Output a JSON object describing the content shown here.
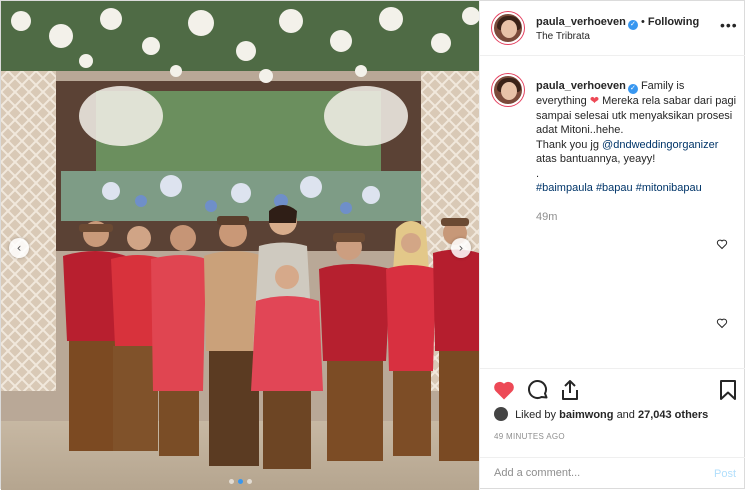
{
  "header": {
    "username": "paula_verhoeven",
    "separator": "•",
    "follow_status": "Following",
    "location": "The Tribrata",
    "more_icon": "more-horizontal-icon"
  },
  "caption": {
    "username": "paula_verhoeven",
    "text_1": "Family is everything",
    "text_2": "Mereka rela sabar dari pagi sampai selesai utk menyaksikan prosesi adat Mitoni..hehe.",
    "text_3": "Thank you jg",
    "mention": "@dndweddingorganizer",
    "text_4": "atas bantuannya, yeayy!",
    "dot_line": ".",
    "hashtags": [
      "#baimpaula",
      "#bapau",
      "#mitonibapau"
    ],
    "time": "49m"
  },
  "actions": {
    "like_icon": "heart-filled-icon",
    "comment_icon": "comment-icon",
    "share_icon": "share-icon",
    "save_icon": "bookmark-icon",
    "liked": true
  },
  "likes": {
    "prefix": "Liked by",
    "liker": "baimwong",
    "connector": "and",
    "others": "27,043 others"
  },
  "post_age": "49 MINUTES AGO",
  "comment": {
    "placeholder": "Add a comment...",
    "post_label": "Post"
  },
  "carousel": {
    "prev_glyph": "‹",
    "next_glyph": "›",
    "slide_count": 3,
    "active_index": 1
  },
  "colors": {
    "like_red": "#ed4956",
    "verified_blue": "#3897f0",
    "hashtag_blue": "#003569",
    "post_disabled": "#b2dffc"
  }
}
